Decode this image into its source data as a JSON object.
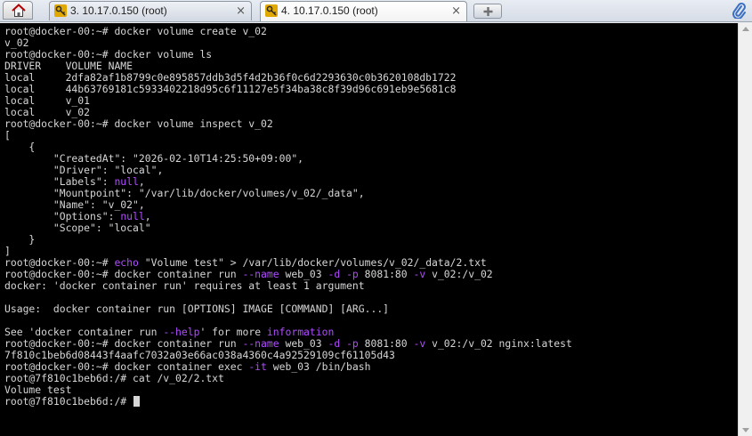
{
  "tabs": [
    {
      "title": "3. 10.17.0.150 (root)",
      "active": false,
      "close": "×"
    },
    {
      "title": "4. 10.17.0.150 (root)",
      "active": true,
      "close": "×"
    }
  ],
  "icons": {
    "home": "home-icon",
    "tab": "key-icon",
    "new_tab": "plus-icon",
    "attach": "paperclip-icon"
  },
  "colors": {
    "terminal_bg": "#000000",
    "terminal_fg": "#d6d6d6",
    "highlight": "#b04cff"
  },
  "terminal": {
    "lines": [
      [
        {
          "t": "root@docker-00:~# docker volume create v_02"
        }
      ],
      [
        {
          "t": "v_02"
        }
      ],
      [
        {
          "t": "root@docker-00:~# docker volume ls"
        }
      ],
      [
        {
          "t": "DRIVER    VOLUME NAME"
        }
      ],
      [
        {
          "t": "local     2dfa82af1b8799c0e895857ddb3d5f4d2b36f0c6d2293630c0b3620108db1722"
        }
      ],
      [
        {
          "t": "local     44b63769181c5933402218d95c6f11127e5f34ba38c8f39d96c691eb9e5681c8"
        }
      ],
      [
        {
          "t": "local     v_01"
        }
      ],
      [
        {
          "t": "local     v_02"
        }
      ],
      [
        {
          "t": "root@docker-00:~# docker volume inspect v_02"
        }
      ],
      [
        {
          "t": "["
        }
      ],
      [
        {
          "t": "    {"
        }
      ],
      [
        {
          "t": "        \"CreatedAt\": \"2026-02-10T14:25:50+09:00\","
        }
      ],
      [
        {
          "t": "        \"Driver\": \"local\","
        }
      ],
      [
        {
          "t": "        \"Labels\": "
        },
        {
          "t": "null",
          "c": "kw"
        },
        {
          "t": ","
        }
      ],
      [
        {
          "t": "        \"Mountpoint\": \"/var/lib/docker/volumes/v_02/_data\","
        }
      ],
      [
        {
          "t": "        \"Name\": \"v_02\","
        }
      ],
      [
        {
          "t": "        \"Options\": "
        },
        {
          "t": "null",
          "c": "kw"
        },
        {
          "t": ","
        }
      ],
      [
        {
          "t": "        \"Scope\": \"local\""
        }
      ],
      [
        {
          "t": "    }"
        }
      ],
      [
        {
          "t": "]"
        }
      ],
      [
        {
          "t": "root@docker-00:~# "
        },
        {
          "t": "echo",
          "c": "kw"
        },
        {
          "t": " \"Volume test\" > /var/lib/docker/volumes/v_02/_data/2.txt"
        }
      ],
      [
        {
          "t": "root@docker-00:~# docker container run "
        },
        {
          "t": "--name",
          "c": "kw"
        },
        {
          "t": " web_03 "
        },
        {
          "t": "-d",
          "c": "kw"
        },
        {
          "t": " "
        },
        {
          "t": "-p",
          "c": "kw"
        },
        {
          "t": " 8081:80 "
        },
        {
          "t": "-v",
          "c": "kw"
        },
        {
          "t": " v_02:/v_02"
        }
      ],
      [
        {
          "t": "docker: 'docker container run' requires at least 1 argument"
        }
      ],
      [
        {
          "t": ""
        }
      ],
      [
        {
          "t": "Usage:  docker container run [OPTIONS] IMAGE [COMMAND] [ARG...]"
        }
      ],
      [
        {
          "t": ""
        }
      ],
      [
        {
          "t": "See 'docker container run "
        },
        {
          "t": "--help",
          "c": "kw"
        },
        {
          "t": "' for more "
        },
        {
          "t": "information",
          "c": "kw"
        }
      ],
      [
        {
          "t": "root@docker-00:~# docker container run "
        },
        {
          "t": "--name",
          "c": "kw"
        },
        {
          "t": " web_03 "
        },
        {
          "t": "-d",
          "c": "kw"
        },
        {
          "t": " "
        },
        {
          "t": "-p",
          "c": "kw"
        },
        {
          "t": " 8081:80 "
        },
        {
          "t": "-v",
          "c": "kw"
        },
        {
          "t": " v_02:/v_02 nginx:latest"
        }
      ],
      [
        {
          "t": "7f810c1beb6d08443f4aafc7032a03e66ac038a4360c4a92529109cf61105d43"
        }
      ],
      [
        {
          "t": "root@docker-00:~# docker container exec "
        },
        {
          "t": "-it",
          "c": "kw"
        },
        {
          "t": " web_03 /bin/bash"
        }
      ],
      [
        {
          "t": "root@7f810c1beb6d:/# cat /v_02/2.txt"
        }
      ],
      [
        {
          "t": "Volume test"
        }
      ],
      [
        {
          "t": "root@7f810c1beb6d:/# "
        }
      ]
    ]
  }
}
